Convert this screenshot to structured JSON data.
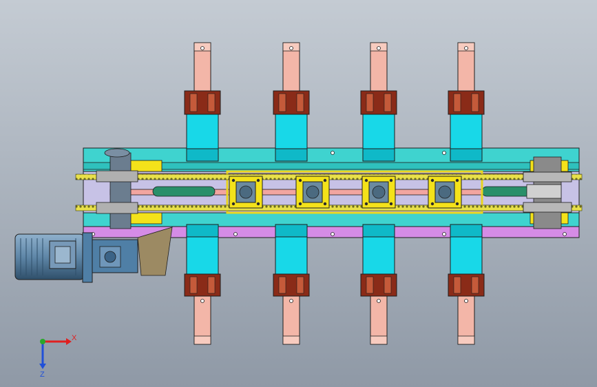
{
  "view": {
    "background_top": "#c4cbd3",
    "background_bottom": "#8f99a6"
  },
  "colors": {
    "frame_cyan": "#3fd3cf",
    "module_cyan": "#18d8e8",
    "rail_pink": "#f2a5a0",
    "post_salmon": "#f3b6a8",
    "bearing_brown": "#8a2b18",
    "bearing_light": "#c55a3a",
    "chain_yellow": "#e8e04a",
    "guide_yellow": "#f4e21a",
    "magenta_bar": "#d58ce6",
    "motor_blue": "#5f87a8",
    "gearbox_blue": "#4f7fa6",
    "bracket_tan": "#9c8a63",
    "outline": "#1d1d1d",
    "axis_x": "#e02020",
    "axis_y": "#2aa82a",
    "axis_z": "#2050d8"
  },
  "stations": [
    {
      "id": "s1"
    },
    {
      "id": "s2"
    },
    {
      "id": "s3"
    },
    {
      "id": "s4"
    }
  ],
  "triad": {
    "x_label": "X",
    "z_label": "Z"
  }
}
